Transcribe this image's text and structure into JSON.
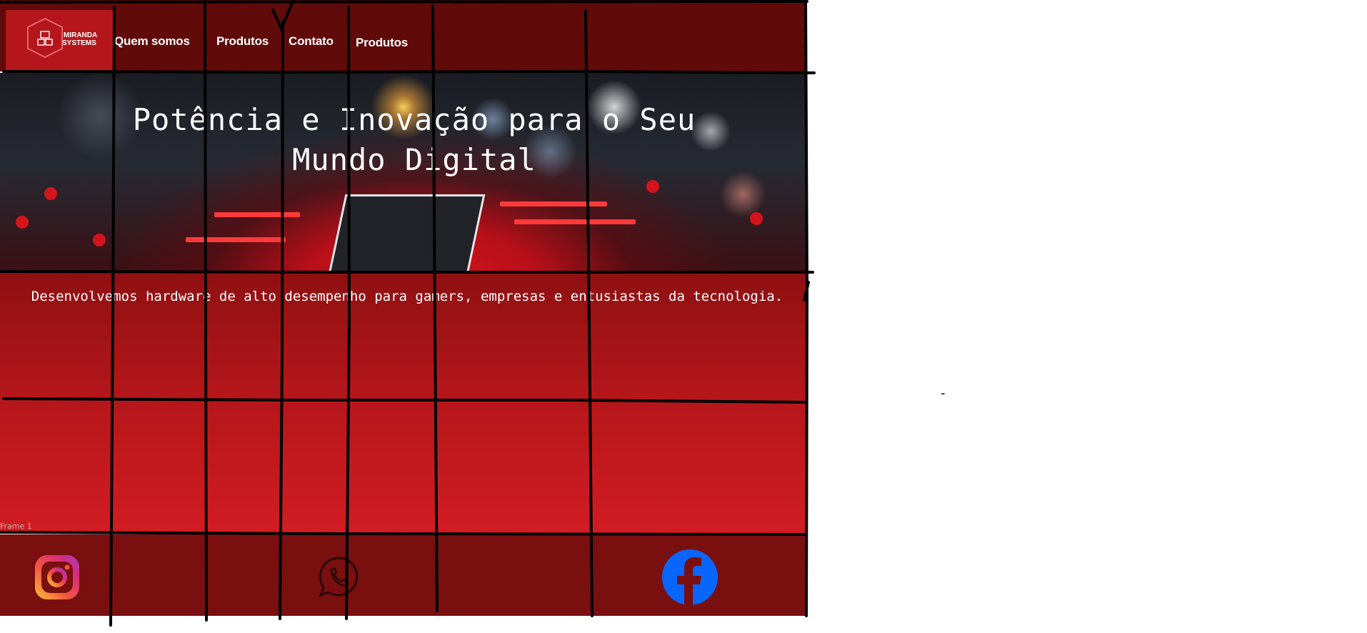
{
  "brand": {
    "logo_line1": "MIRANDA",
    "logo_line2": "SYSTEMS"
  },
  "nav": {
    "items": [
      {
        "label": "Quem somos"
      },
      {
        "label": "Produtos"
      },
      {
        "label": "Contato"
      },
      {
        "label": "Produtos"
      }
    ]
  },
  "hero": {
    "title": "Potência e Inovação para o Seu Mundo Digital"
  },
  "main": {
    "description": "Desenvolvemos hardware de alto desempenho para gamers, empresas e entusiastas da tecnologia.",
    "frame_label": "Frame 1"
  },
  "footer": {
    "icons": [
      "instagram-icon",
      "whatsapp-icon",
      "facebook-icon"
    ]
  },
  "canvas": {
    "stray_mark": "-"
  },
  "colors": {
    "header_bg": "#600a0a",
    "logo_bg": "#b5161c",
    "footer_bg": "#7a0f10",
    "facebook_blue": "#0866ff"
  }
}
